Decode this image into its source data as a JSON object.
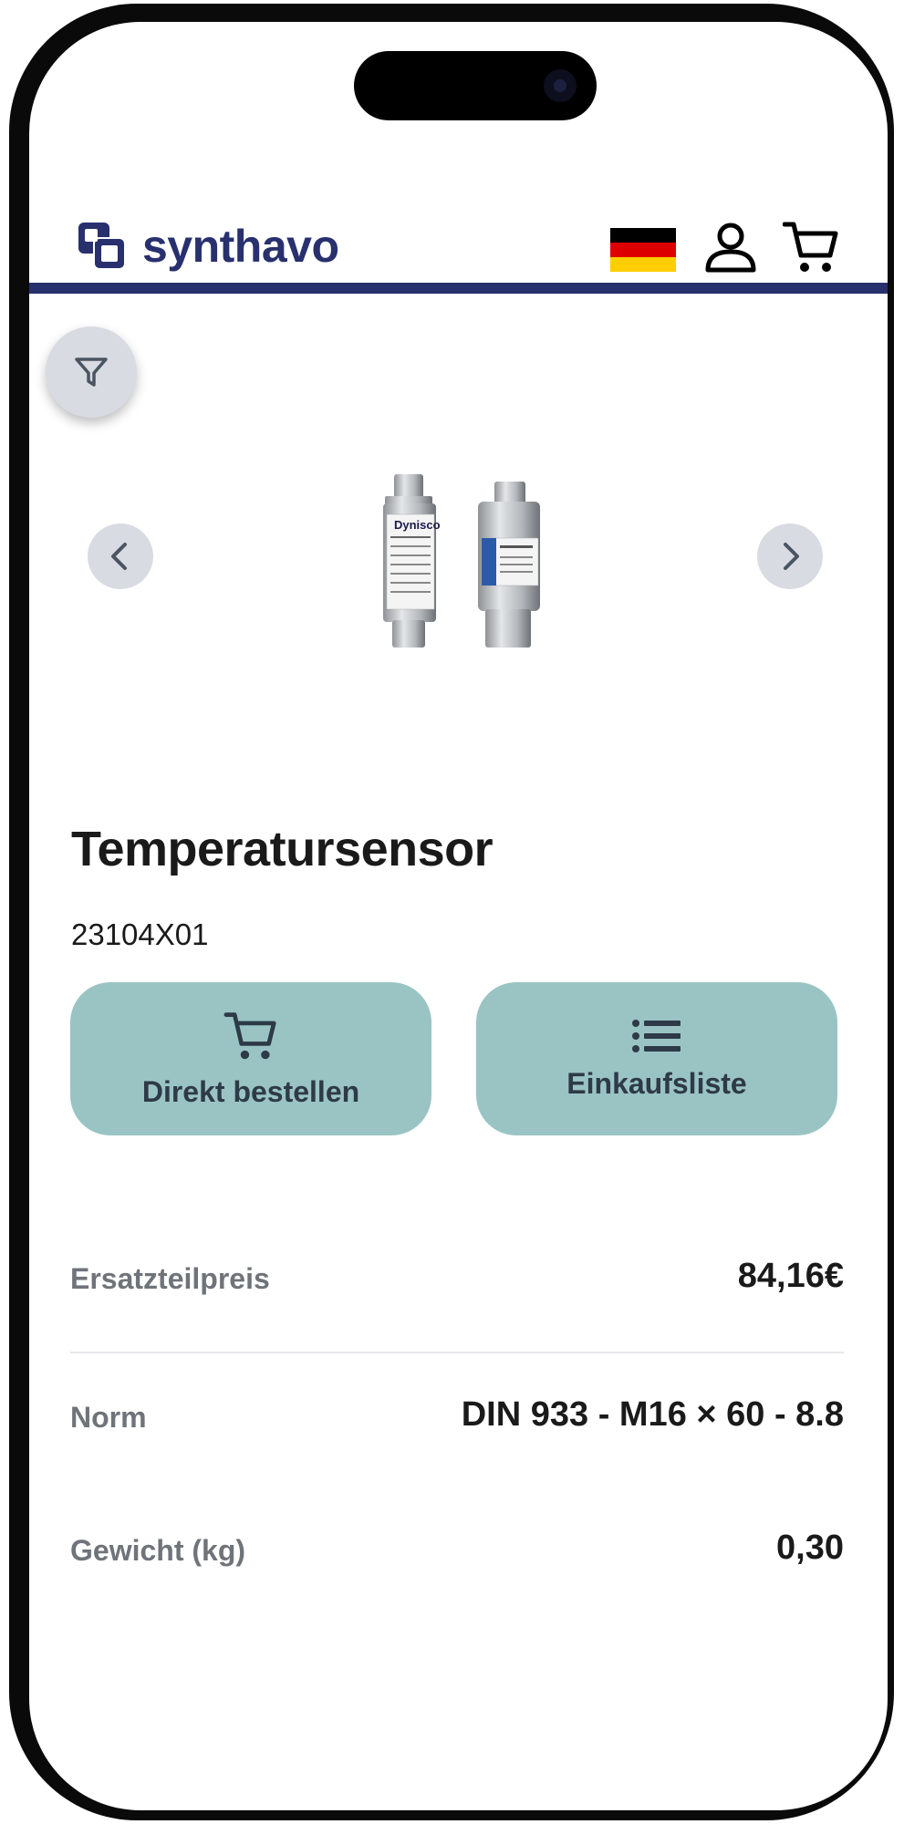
{
  "header": {
    "brand": "synthavo",
    "language_flag": "german-flag",
    "colors": {
      "brand": "#28306e",
      "accent_bar": "#28306e"
    }
  },
  "filter": {
    "icon": "filter-icon"
  },
  "carousel": {
    "prev_icon": "chevron-left-icon",
    "next_icon": "chevron-right-icon"
  },
  "product": {
    "title": "Temperatursensor",
    "sku": "23104X01",
    "image_brand_label": "Dynisco"
  },
  "actions": {
    "order_label": "Direkt bestellen",
    "list_label": "Einkaufsliste",
    "button_color": "#9ac4c4"
  },
  "details": [
    {
      "key": "Ersatzteilpreis",
      "value": "84,16€"
    },
    {
      "key": "Norm",
      "value": "DIN 933 - M16 × 60 - 8.8"
    },
    {
      "key": "Gewicht (kg)",
      "value": "0,30"
    }
  ]
}
